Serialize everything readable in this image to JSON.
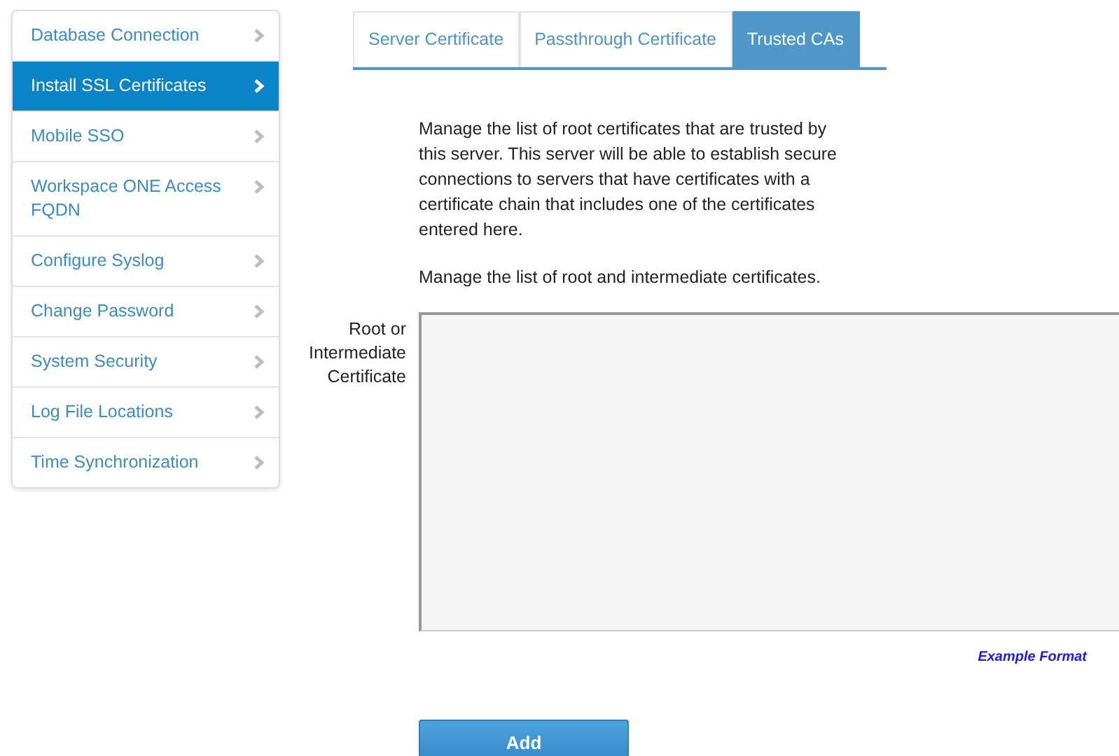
{
  "sidebar": {
    "items": [
      {
        "label": "Database Connection",
        "selected": false
      },
      {
        "label": "Install SSL Certificates",
        "selected": true
      },
      {
        "label": "Mobile SSO",
        "selected": false
      },
      {
        "label": "Workspace ONE Access FQDN",
        "selected": false
      },
      {
        "label": "Configure Syslog",
        "selected": false
      },
      {
        "label": "Change Password",
        "selected": false
      },
      {
        "label": "System Security",
        "selected": false
      },
      {
        "label": "Log File Locations",
        "selected": false
      },
      {
        "label": "Time Synchronization",
        "selected": false
      }
    ]
  },
  "tabs": [
    {
      "label": "Server Certificate",
      "selected": false
    },
    {
      "label": "Passthrough Certificate",
      "selected": false
    },
    {
      "label": "Trusted CAs",
      "selected": true
    }
  ],
  "description": [
    "Manage the list of root certificates that are trusted by this server. This server will be able to establish secure connections to servers that have certificates with a certificate chain that includes one of the certificates entered here.",
    "Manage the list of root and intermediate certificates."
  ],
  "form": {
    "label": "Root or Intermediate Certificate",
    "example_link": "Example Format",
    "button": "Add"
  }
}
